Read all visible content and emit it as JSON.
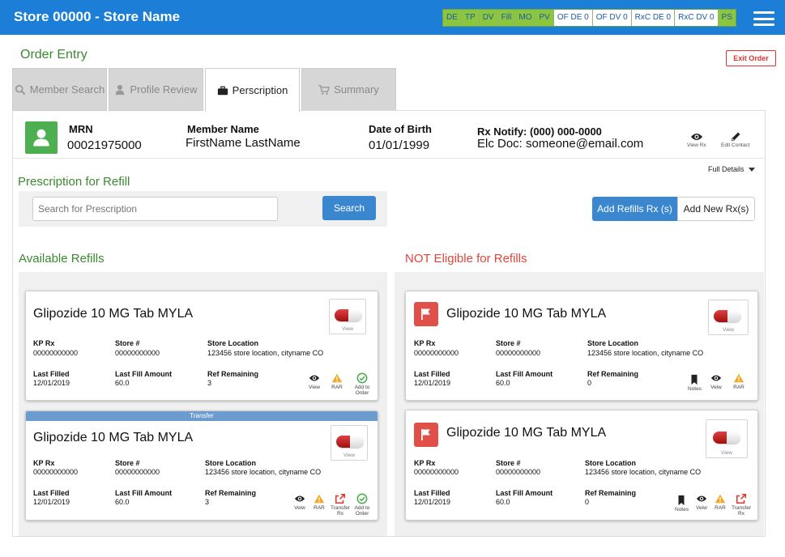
{
  "header": {
    "store_title": "Store 00000 - Store Name",
    "status_items": [
      {
        "label": "DE",
        "state": "on"
      },
      {
        "label": "TP",
        "state": "on"
      },
      {
        "label": "DV",
        "state": "on"
      },
      {
        "label": "Fill",
        "state": "on"
      },
      {
        "label": "MO",
        "state": "on"
      },
      {
        "label": "PV",
        "state": "on"
      },
      {
        "label": "OF DE 0",
        "state": "off"
      },
      {
        "label": "OF DV 0",
        "state": "off"
      },
      {
        "label": "RxC DE 0",
        "state": "off"
      },
      {
        "label": "RxC DV 0",
        "state": "off"
      },
      {
        "label": "PS",
        "state": "on"
      }
    ]
  },
  "page": {
    "title": "Order Entry",
    "exit_label": "Exit Order"
  },
  "tabs": [
    {
      "label": "Member Search"
    },
    {
      "label": "Profile Review"
    },
    {
      "label": "Perscription"
    },
    {
      "label": "Summary"
    }
  ],
  "member": {
    "mrn_label": "MRN",
    "mrn_value": "00021975000",
    "name_label": "Member Name",
    "name_value": "FirstName LastName",
    "dob_label": "Date of Birth",
    "dob_value": "01/01/1999",
    "rx_notify": "Rx Notify: (000) 000-0000",
    "elc_doc": "Elc Doc: someone@email.com",
    "view_rx_label": "View Rx",
    "edit_contact_label": "Edit Contact"
  },
  "refill": {
    "full_details": "Full Details",
    "title": "Prescription for Refill",
    "search_placeholder": "Search for Prescription",
    "search_label": "Search",
    "add_refills_label": "Add Refills Rx (s)",
    "add_new_label": "Add New Rx(s)"
  },
  "available": {
    "title": "Available Refills",
    "cards": [
      {
        "banner": "",
        "drug": "Glipozide 10 MG Tab MYLA",
        "view_label": "View",
        "kp_rx_label": "KP Rx",
        "kp_rx": "00000000000",
        "store_label": "Store #",
        "store": "00000000000",
        "location_label": "Store Location",
        "location": "123456 store location, cityname CO",
        "last_filled_label": "Last Filled",
        "last_filled": "12/01/2019",
        "last_amount_label": "Last Fill Amount",
        "last_amount": "60.0",
        "ref_label": "Ref Remaining",
        "ref": "3",
        "actions": [
          "View",
          "RAR",
          "Add to Order"
        ]
      },
      {
        "banner": "Transfer",
        "drug": "Glipozide 10 MG Tab MYLA",
        "view_label": "View",
        "kp_rx_label": "KP Rx",
        "kp_rx": "00000000000",
        "store_label": "Store #",
        "store": "00000000000",
        "location_label": "Store Location",
        "location": "123456 store location, cityname CO",
        "last_filled_label": "Last Filled",
        "last_filled": "12/01/2019",
        "last_amount_label": "Last Fill Amount",
        "last_amount": "60.0",
        "ref_label": "Ref Remaining",
        "ref": "3",
        "actions": [
          "Veiw",
          "RAR",
          "Transfer Rx",
          "Add to Order"
        ]
      }
    ]
  },
  "not_eligible": {
    "title": "NOT Eligible for Refills",
    "cards": [
      {
        "drug": "Glipozide 10 MG Tab MYLA",
        "view_label": "View",
        "kp_rx_label": "KP Rx",
        "kp_rx": "00000000000",
        "store_label": "Store #",
        "store": "00000000000",
        "location_label": "Store Location",
        "location": "123456 store location, cityname CO",
        "last_filled_label": "Last Filled",
        "last_filled": "12/01/2019",
        "last_amount_label": "Last Fill Amount",
        "last_amount": "60.0",
        "ref_label": "Ref Remaining",
        "ref": "0",
        "actions": [
          "Notes",
          "Veiw",
          "RAR"
        ]
      },
      {
        "drug": "Glipozide 10 MG Tab MYLA",
        "view_label": "View",
        "kp_rx_label": "KP Rx",
        "kp_rx": "00000000000",
        "store_label": "Store #",
        "store": "00000000000",
        "location_label": "Store Location",
        "location": "123456 store location, cityname CO",
        "last_filled_label": "Last Filled",
        "last_filled": "12/01/2019",
        "last_amount_label": "Last Fill Amount",
        "last_amount": "60.0",
        "ref_label": "Ref Remaining",
        "ref": "0",
        "actions": [
          "Notes",
          "Veiw",
          "RAR",
          "Transfer Rx"
        ]
      }
    ]
  },
  "colors": {
    "header_blue": "#1c7ed6",
    "accent_green": "#3a8a2f",
    "alert_red": "#e0473c",
    "button_blue": "#3b87cf",
    "status_green": "#8cc63f"
  }
}
